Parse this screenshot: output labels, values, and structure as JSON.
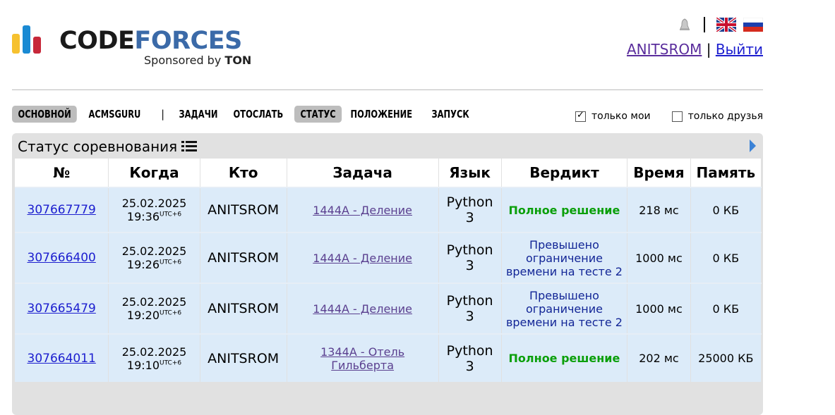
{
  "header": {
    "logo_left": "CODE",
    "logo_right": "FORCES",
    "sponsor_text": "Sponsored by",
    "sponsor_name": "TON",
    "username": "ANITSROM",
    "logout": "Выйти",
    "separator": "|"
  },
  "menu": {
    "items": [
      "ОСНОВНОЙ",
      "ACMSGURU",
      "ЗАДАЧИ",
      "ОТОСЛАТЬ",
      "СТАТУС",
      "ПОЛОЖЕНИЕ",
      "ЗАПУСК"
    ],
    "pipe": "|",
    "active": [
      "ОСНОВНОЙ",
      "СТАТУС"
    ],
    "filter_mine": "только мои",
    "filter_friends": "только друзья",
    "filter_mine_checked": true,
    "filter_friends_checked": false
  },
  "status": {
    "title": "Статус соревнования",
    "columns": [
      "№",
      "Когда",
      "Кто",
      "Задача",
      "Язык",
      "Вердикт",
      "Время",
      "Память"
    ],
    "rows": [
      {
        "id": "307667779",
        "date": "25.02.2025",
        "time": "19:36",
        "tz": "UTC+6",
        "who": "ANITSROM",
        "problem": "1444A - Деление",
        "lang1": "Python",
        "lang2": "3",
        "verdict": "Полное решение",
        "verdict_type": "ok",
        "runtime": "218 мс",
        "memory": "0 КБ"
      },
      {
        "id": "307666400",
        "date": "25.02.2025",
        "time": "19:26",
        "tz": "UTC+6",
        "who": "ANITSROM",
        "problem": "1444A - Деление",
        "lang1": "Python",
        "lang2": "3",
        "verdict": "Превышено ограничение времени на тесте 2",
        "verdict_type": "tl",
        "runtime": "1000 мс",
        "memory": "0 КБ"
      },
      {
        "id": "307665479",
        "date": "25.02.2025",
        "time": "19:20",
        "tz": "UTC+6",
        "who": "ANITSROM",
        "problem": "1444A - Деление",
        "lang1": "Python",
        "lang2": "3",
        "verdict": "Превышено ограничение времени на тесте 2",
        "verdict_type": "tl",
        "runtime": "1000 мс",
        "memory": "0 КБ"
      },
      {
        "id": "307664011",
        "date": "25.02.2025",
        "time": "19:10",
        "tz": "UTC+6",
        "who": "ANITSROM",
        "problem": "1344A - Отель Гильберта",
        "lang1": "Python",
        "lang2": "3",
        "verdict": "Полное решение",
        "verdict_type": "ok",
        "runtime": "202 мс",
        "memory": "25000 КБ"
      }
    ]
  },
  "colors": {
    "accent_link": "#1c1ecf",
    "ok": "#0a9f0a",
    "tl": "#122596",
    "row_bg": "#dcebf9"
  }
}
